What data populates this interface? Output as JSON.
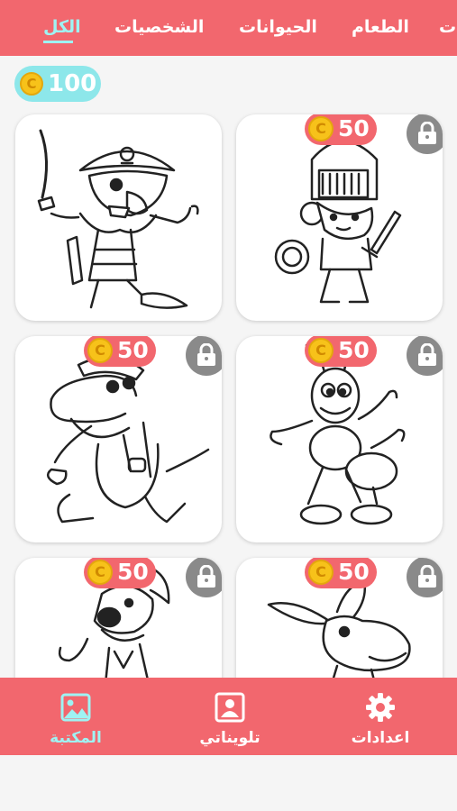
{
  "tabs": [
    {
      "label": "الكل",
      "active": true
    },
    {
      "label": "الشخصيات",
      "active": false
    },
    {
      "label": "الحيوانات",
      "active": false
    },
    {
      "label": "الطعام",
      "active": false
    },
    {
      "label": "ات",
      "active": false
    }
  ],
  "balance": {
    "coins": "100",
    "coin_symbol": "C"
  },
  "cards": [
    {
      "subject": "pirate",
      "locked": false,
      "price": null
    },
    {
      "subject": "knight",
      "locked": true,
      "price": "50"
    },
    {
      "subject": "crocodile",
      "locked": true,
      "price": "50"
    },
    {
      "subject": "ant",
      "locked": true,
      "price": "50"
    },
    {
      "subject": "dog",
      "locked": true,
      "price": "50"
    },
    {
      "subject": "donkey",
      "locked": true,
      "price": "50"
    }
  ],
  "coin_symbol": "C",
  "bottom_nav": [
    {
      "label": "المكتبة",
      "icon": "image-icon",
      "active": true
    },
    {
      "label": "تلويناتي",
      "icon": "portrait-icon",
      "active": false
    },
    {
      "label": "اعدادات",
      "icon": "gear-icon",
      "active": false
    }
  ],
  "colors": {
    "primary": "#f2676e",
    "accent": "#9ef3f3",
    "coin": "#f7c21a",
    "lock": "#8a8a8a"
  }
}
